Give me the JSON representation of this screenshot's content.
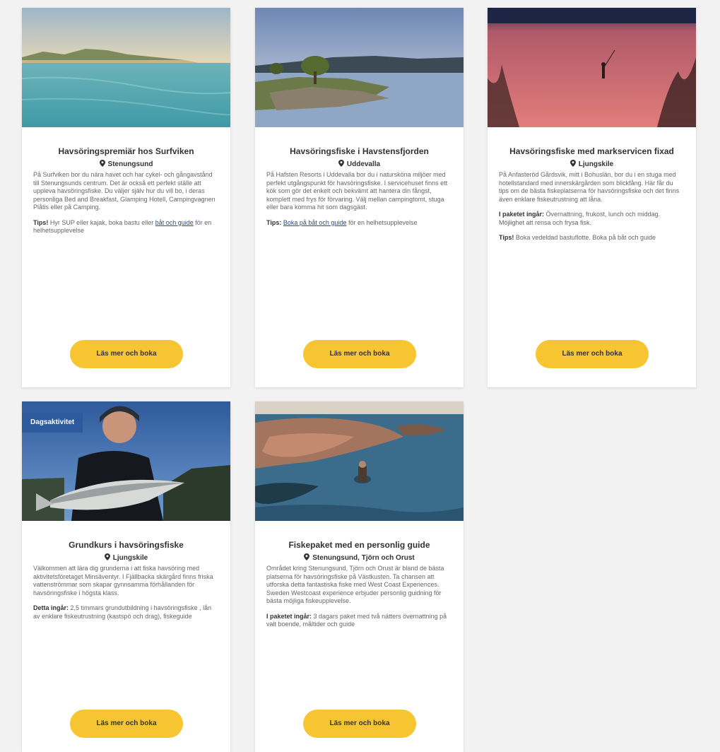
{
  "cards": [
    {
      "title": "Havsöringspremiär hos Surfviken",
      "location": "Stenungsund",
      "description": "På Surfviken bor du nära havet och har cykel- och gångavstånd till Stenungsunds centrum. Det är också ett perfekt ställe att uppleva havsöringsfiske. Du väljer själv hur du vill bo, i deras personliga Bed and Breakfast, Glamping Hotell, Campingvagnen Plåtis eller på Camping.",
      "p1_label": "Tips!",
      "p1_text_before": " Hyr SUP eller kajak, boka bastu eller ",
      "p1_link": "båt och guide",
      "p1_text_after": " för en helhetsupplevelse",
      "button": "Läs mer och boka"
    },
    {
      "title": "Havsöringsfiske i Havstensfjorden",
      "location": "Uddevalla",
      "description": "På Hafsten Resorts i Uddevalla bor du i natursköna miljöer med perfekt utgångspunkt för havsöringsfiske. I servicehuset finns ett kök som gör det enkelt och bekvämt att hantera din fångst, komplett med frys för förvaring. Välj mellan campingtomt, stuga eller bara komma hit som dagsgäst.",
      "p1_label": "Tips:",
      "p1_link": "Boka på båt och guide",
      "p1_text_after": " för en helhetsupplevelse",
      "button": "Läs mer och boka"
    },
    {
      "title": "Havsöringsfiske med markservicen fixad",
      "location": "Ljungskile",
      "description": "På Anfasteröd Gårdsvik, mitt i Bohuslän, bor du i en stuga med hotellstandard med innerskärgården som blickfång. Här får du tips om de bästa fiskeplatserna för havsöringsfiske och det finns även enklare fiskeutrustning att låna.",
      "p1_label": "I paketet ingår:",
      "p1_text_after": " Övernattning, frukost, lunch och middag. Möjlighet att rensa och frysa fisk.",
      "p2_label": "Tips!",
      "p2_text": " Boka vedeldad bastuflotte. Boka på båt och guide",
      "button": "Läs mer och boka"
    },
    {
      "badge": "Dagsaktivitet",
      "title": "Grundkurs i havsöringsfiske",
      "location": "Ljungskile",
      "description": "Välkommen att lära dig grunderna i att fiska havsöring med aktivitetsföretaget Minsäventyr. I Fjällbacka skärgård finns friska vattenströmmar som skapar gynnsamma förhållanden för havsöringsfiske i högsta klass.",
      "p1_label": "Detta ingår:",
      "p1_text_after": " 2,5 timmars grundutbildning i havsöringsfiske , lån av enklare fiskeutrustning (kastspö och drag), fiskeguide",
      "button": "Läs mer och boka"
    },
    {
      "title": "Fiskepaket med en personlig guide",
      "location": "Stenungsund, Tjörn och Orust",
      "description": "Området kring Stenungsund, Tjörn och Orust är bland de bästa platserna för havsöringsfiske på Västkusten. Ta chansen att utforska detta fantastiska fiske med West Coast Experiences. Sweden Westcoast experience erbjuder personlig guidning för bästa möjliga fiskeupplevelse.",
      "p1_label": "I paketet ingår:",
      "p1_text_after": " 3 dagars paket med två nätters övernattning på valt boende, måltider och guide",
      "button": "Läs mer och boka"
    }
  ],
  "colors": {
    "button": "#f8c532",
    "badge": "#2d5a9c",
    "link": "#2d4a8c",
    "background": "#f2f2f2"
  }
}
